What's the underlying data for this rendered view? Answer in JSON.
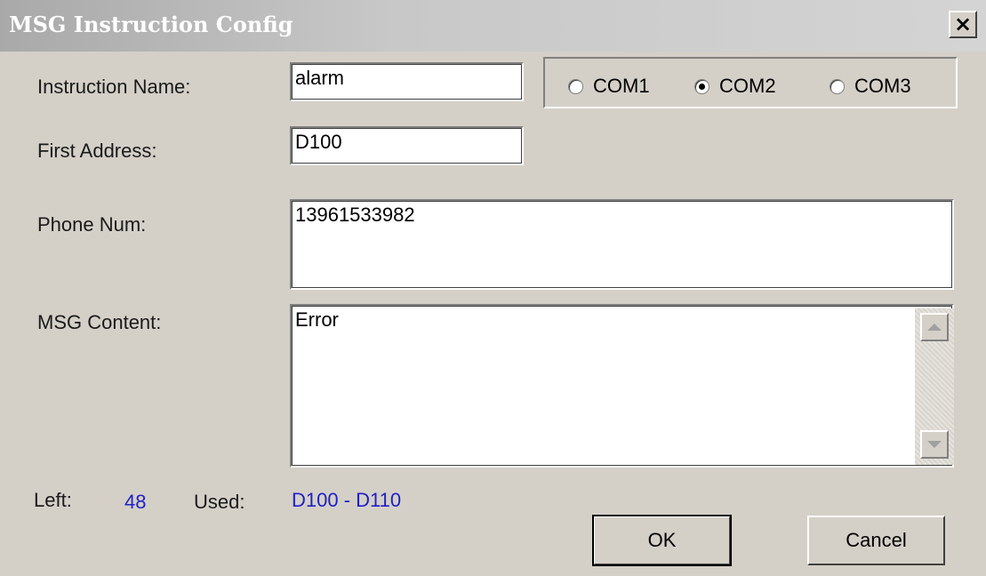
{
  "window": {
    "title": "MSG Instruction Config",
    "close_glyph": "×",
    "close_icon": "close-icon"
  },
  "form": {
    "instruction_name_label": "Instruction Name:",
    "instruction_name_value": "alarm",
    "first_address_label": "First Address:",
    "first_address_value": "D100",
    "phone_num_label": "Phone Num:",
    "phone_num_value": "13961533982",
    "msg_content_label": "MSG Content:",
    "msg_content_value": "Error"
  },
  "ports": {
    "options": [
      "COM1",
      "COM2",
      "COM3"
    ],
    "selected": "COM2"
  },
  "status": {
    "left_label": "Left:",
    "left_value": "48",
    "used_label": "Used:",
    "used_value": "D100 - D110",
    "value_color": "#1f1fc9"
  },
  "buttons": {
    "ok_label": "OK",
    "cancel_label": "Cancel"
  }
}
